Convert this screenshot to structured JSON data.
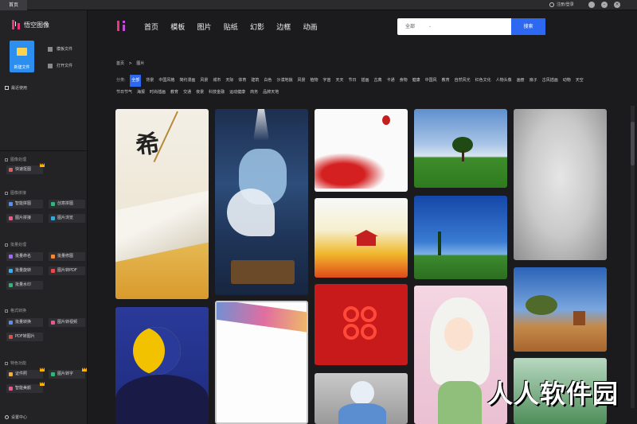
{
  "titlebar": {
    "tab": "首页",
    "user": "注册/登录"
  },
  "sidebar": {
    "app_name": "悟空图像",
    "new_file": "新建文件",
    "template_file": "模板文件",
    "open_file": "打开文件",
    "recent": "最近使用",
    "sections": [
      {
        "title": "图像处理",
        "tools": [
          "快速抠图"
        ]
      },
      {
        "title": "图像拼接",
        "tools": [
          "智能拼图",
          "创意拼图",
          "图片拼接",
          "图片浏览"
        ]
      },
      {
        "title": "批量处理",
        "tools": [
          "批量命名",
          "批量修图",
          "批量旋转",
          "图片转PDF",
          "批量水印"
        ]
      },
      {
        "title": "格式转换",
        "tools": [
          "批量转换",
          "图片转视频",
          "PDF转图片"
        ]
      },
      {
        "title": "特色功能",
        "tools": [
          "证件照",
          "图片转字",
          "智能美颜"
        ]
      }
    ],
    "settings": "设置中心"
  },
  "topnav": [
    "首页",
    "模板",
    "图片",
    "贴纸",
    "幻影",
    "边框",
    "动画"
  ],
  "search": {
    "category": "全部",
    "button": "搜索"
  },
  "breadcrumb": [
    "首页",
    ">",
    "图片"
  ],
  "categories": {
    "label": "分类:",
    "items": [
      "全部",
      "背景",
      "中国风格",
      "简约漫画",
      "风景",
      "城市",
      "天际",
      "体育",
      "建筑",
      "白色",
      "沙漠地貌",
      "风景",
      "植物",
      "宇宙",
      "天天",
      "节日",
      "插画",
      "古典",
      "卡通",
      "食物",
      "健康",
      "中国风",
      "教育",
      "自然风光",
      "红色文化",
      "人物头像",
      "画册",
      "扇子",
      "古风插画",
      "动物",
      "天空",
      "节日节气",
      "海报",
      "时尚插画",
      "教育",
      "交通",
      "夜景",
      "科技金融",
      "运动健康",
      "商务",
      "品牌天地"
    ],
    "selected": 0
  },
  "images": [
    "autumn-poster",
    "girl-with-fish",
    "tiananmen-watercolor",
    "tree-on-meadow",
    "grey-texture",
    "great-wall-city",
    "blue-sky-field",
    "desert-tree",
    "moon-night",
    "ribbon-frame",
    "red-festive",
    "anime-girl",
    "doctor-illustration",
    "green-leaves"
  ],
  "watermark": "人人软件园",
  "colors": {
    "accent": "#2d68f0",
    "brand": "#e8367a",
    "newfile": "#2c8ff0"
  }
}
